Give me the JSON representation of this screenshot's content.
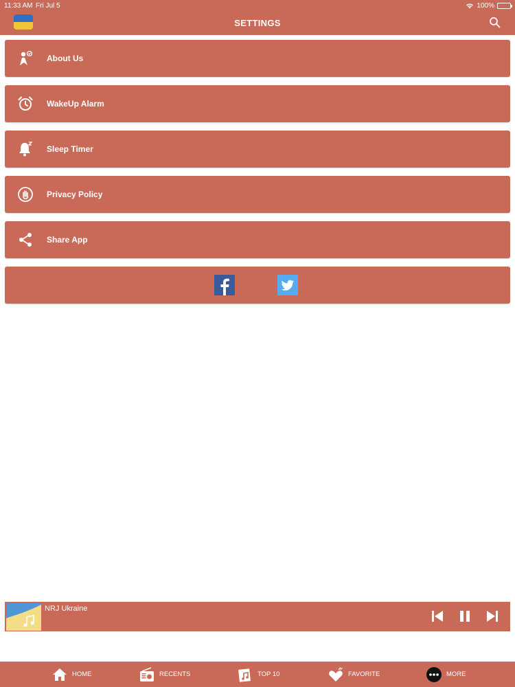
{
  "status_bar": {
    "time": "11:33 AM",
    "date": "Fri Jul 5",
    "battery": "100%"
  },
  "header": {
    "title": "SETTINGS"
  },
  "menu": [
    {
      "label": "About Us",
      "icon": "about-icon"
    },
    {
      "label": "WakeUp Alarm",
      "icon": "alarm-clock-icon"
    },
    {
      "label": "Sleep Timer",
      "icon": "sleep-bell-icon"
    },
    {
      "label": "Privacy Policy",
      "icon": "privacy-hand-icon"
    },
    {
      "label": "Share App",
      "icon": "share-icon"
    }
  ],
  "social": [
    "facebook-icon",
    "twitter-icon"
  ],
  "player": {
    "station": "NRJ Ukraine"
  },
  "tabs": [
    {
      "label": "HOME",
      "icon": "home-icon"
    },
    {
      "label": "RECENTS",
      "icon": "radio-icon"
    },
    {
      "label": "TOP 10",
      "icon": "music-note-icon"
    },
    {
      "label": "FAVORITE",
      "icon": "heart-icon"
    },
    {
      "label": "MORE",
      "icon": "more-icon"
    }
  ],
  "colors": {
    "accent": "#c96a58",
    "background": "#ffffff",
    "text": "#ffffff"
  }
}
